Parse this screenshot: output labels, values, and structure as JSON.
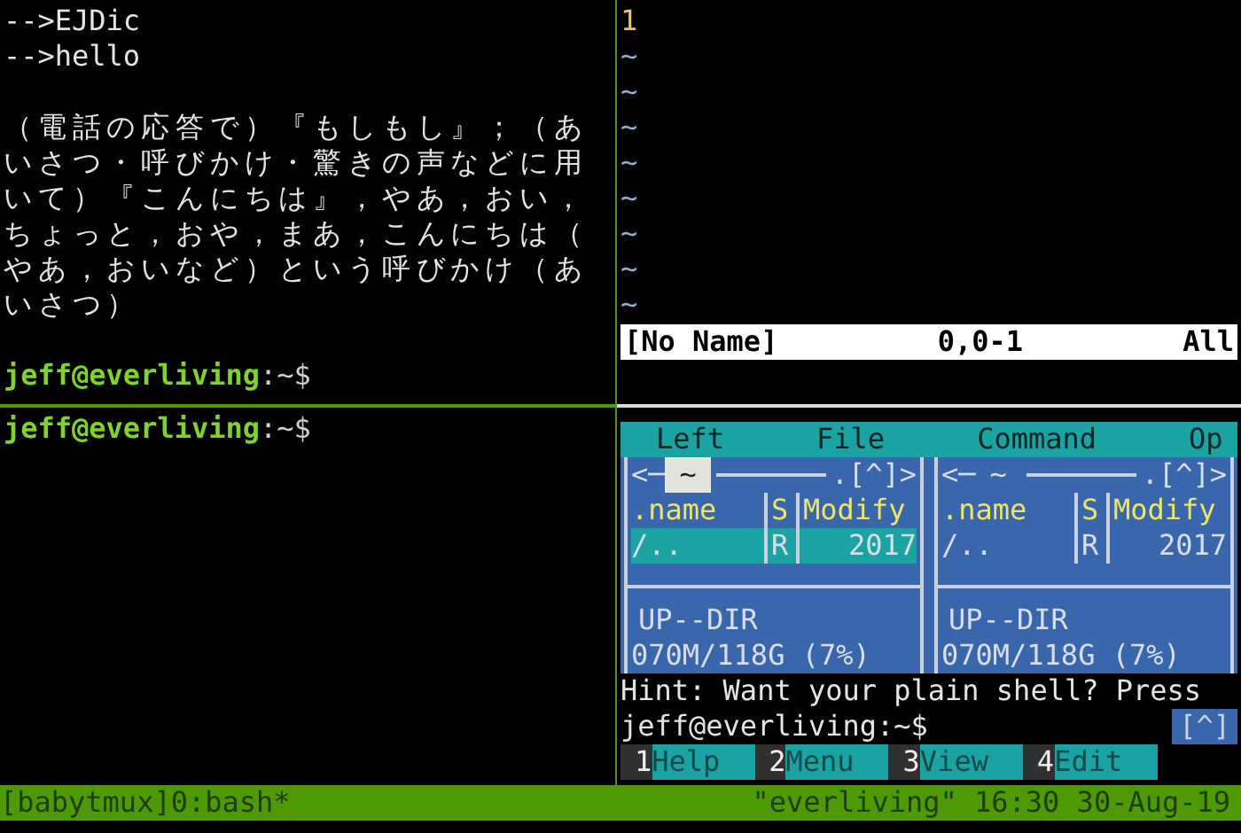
{
  "left_top_pane": {
    "lines": [
      "-->EJDic",
      "-->hello"
    ],
    "definition": [
      "（電話の応答で）『もしもし』；（あ",
      "いさつ・呼びかけ・驚きの声などに用",
      "いて）『こんにちは』，やあ，おい，",
      "ちょっと，おや，まあ，こんにちは（",
      "やあ，おいなど）という呼びかけ（あ",
      "いさつ）"
    ],
    "prompt": {
      "user_host": "jeff@everliving",
      "path": ":~$"
    }
  },
  "left_bottom_pane": {
    "prompt": {
      "user_host": "jeff@everliving",
      "path": ":~$"
    }
  },
  "vim_pane": {
    "line_number": "1",
    "filler_lines": [
      "~",
      "~",
      "~",
      "~",
      "~",
      "~",
      "~",
      "~"
    ],
    "status_line": {
      "file": "[No Name]",
      "position": "0,0-1",
      "scroll": "All"
    }
  },
  "mc_pane": {
    "menu": [
      "Left",
      "File",
      "Command",
      "Op"
    ],
    "panels": [
      {
        "header": {
          "left": "<─",
          "dir": "~",
          "right": ".[^]>"
        },
        "active": true,
        "columns": [
          ".name",
          "S",
          "Modify"
        ],
        "rows": [
          {
            "name": "/..",
            "size": "R",
            "modify": "2017",
            "selected": true
          }
        ],
        "mini_status": "UP--DIR",
        "disk": "070M/118G (7%)"
      },
      {
        "header": {
          "left": "<─",
          "dir": "~",
          "right": ".[^]>"
        },
        "active": false,
        "columns": [
          ".name",
          "S",
          "Modify"
        ],
        "rows": [
          {
            "name": "/..",
            "size": "R",
            "modify": "2017",
            "selected": false
          }
        ],
        "mini_status": "UP--DIR",
        "disk": "070M/118G (7%)"
      }
    ],
    "hint": "Hint: Want your plain shell? Press",
    "prompt": "jeff@everliving:~$",
    "prompt_button": "[^]",
    "function_keys": [
      {
        "number": "1",
        "label": "Help"
      },
      {
        "number": "2",
        "label": "Menu"
      },
      {
        "number": "3",
        "label": "View"
      },
      {
        "number": "4",
        "label": "Edit"
      }
    ]
  },
  "status_bar": {
    "session": "[babytmux]0:bash*",
    "host_time": "\"everliving\" 16:30 30-Aug-19"
  }
}
